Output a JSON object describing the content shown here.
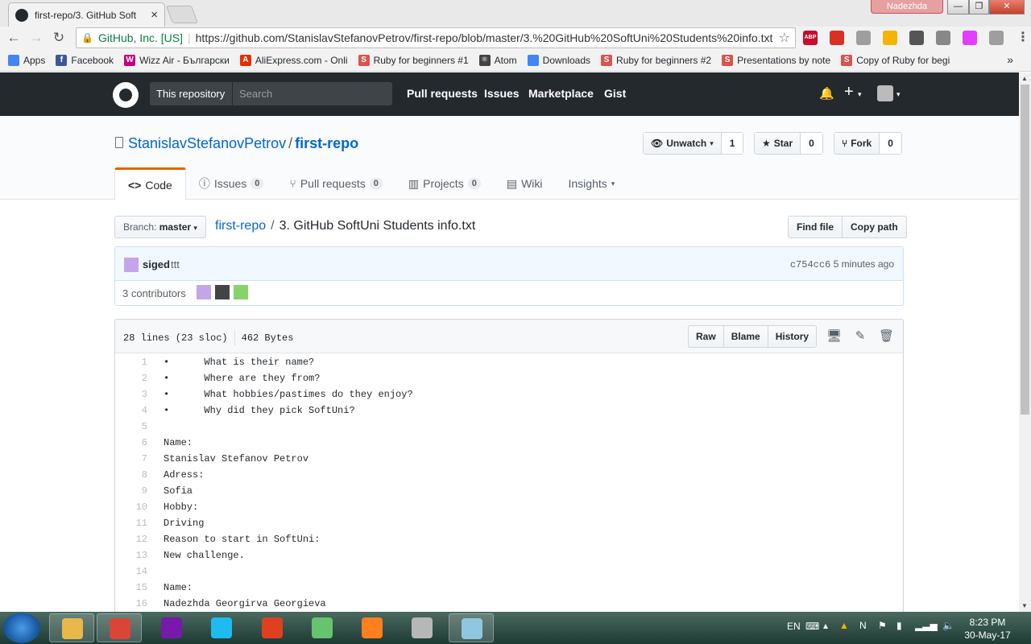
{
  "browser": {
    "tab_title": "first-repo/3. GitHub Soft",
    "tab_close": "×",
    "user_badge": "Nadezhda",
    "window_controls": {
      "minimize": "—",
      "maximize": "❐",
      "close": "✕"
    },
    "nav": {
      "back": "←",
      "forward": "→",
      "reload": "↻"
    },
    "omnibox": {
      "secure_label": "GitHub, Inc. [US]",
      "url": "https://github.com/StanislavStefanovPetrov/first-repo/blob/master/3.%20GitHub%20SoftUni%20Students%20info.txt"
    },
    "extensions": [
      {
        "name": "abp-icon",
        "color": "#c70d2c",
        "label": "ABP"
      },
      {
        "name": "red-ext-icon",
        "color": "#d93025",
        "label": ""
      },
      {
        "name": "drive-ext-icon",
        "color": "#9e9e9e",
        "label": ""
      },
      {
        "name": "yellow-ext-icon",
        "color": "#f4b400",
        "label": ""
      },
      {
        "name": "tools-ext-icon",
        "color": "#555555",
        "label": ""
      },
      {
        "name": "gear-ext-icon",
        "color": "#888888",
        "label": ""
      },
      {
        "name": "gradient-ext-icon",
        "color": "#e040fb",
        "label": ""
      },
      {
        "name": "pdf-ext-icon",
        "color": "#9e9e9e",
        "label": ""
      },
      {
        "name": "menu-icon",
        "color": "#555555",
        "label": "⋮"
      }
    ],
    "bookmarks": [
      {
        "label": "Apps",
        "icon": "apps-icon",
        "color": "#4285f4",
        "glyph": ""
      },
      {
        "label": "Facebook",
        "icon": "facebook-icon",
        "color": "#3b5998",
        "glyph": "f"
      },
      {
        "label": "Wizz Air - Български",
        "icon": "wizzair-icon",
        "color": "#c6007e",
        "glyph": "W"
      },
      {
        "label": "AliExpress.com - Onli",
        "icon": "aliexpress-icon",
        "color": "#e62e04",
        "glyph": "A"
      },
      {
        "label": "Ruby for beginners #1",
        "icon": "softuni-icon",
        "color": "#d9534f",
        "glyph": "S"
      },
      {
        "label": "Atom",
        "icon": "atom-icon",
        "color": "#444444",
        "glyph": "⚛"
      },
      {
        "label": "Downloads",
        "icon": "downloads-icon",
        "color": "#4285f4",
        "glyph": ""
      },
      {
        "label": "Ruby for beginners #2",
        "icon": "softuni-icon",
        "color": "#d9534f",
        "glyph": "S"
      },
      {
        "label": "Presentations by note",
        "icon": "softuni-icon",
        "color": "#d9534f",
        "glyph": "S"
      },
      {
        "label": "Copy of Ruby for begi",
        "icon": "softuni-icon",
        "color": "#d9534f",
        "glyph": "S"
      }
    ],
    "bookmarks_more": "»"
  },
  "github": {
    "scope": "This repository",
    "search_placeholder": "Search",
    "nav": [
      "Pull requests",
      "Issues",
      "Marketplace",
      "Gist"
    ],
    "plus": "+",
    "caret": "▾",
    "bell": "🔔"
  },
  "repo": {
    "owner": "StanislavStefanovPetrov",
    "separator": "/",
    "name": "first-repo",
    "watch": {
      "label": "Unwatch",
      "count": "1"
    },
    "star": {
      "label": "Star",
      "count": "0"
    },
    "fork": {
      "label": "Fork",
      "count": "0"
    },
    "tabs": [
      {
        "label": "Code",
        "count": null,
        "icon": "<>"
      },
      {
        "label": "Issues",
        "count": "0",
        "icon": "ⓘ"
      },
      {
        "label": "Pull requests",
        "count": "0",
        "icon": "⑂"
      },
      {
        "label": "Projects",
        "count": "0",
        "icon": "▥"
      },
      {
        "label": "Wiki",
        "count": null,
        "icon": "▤"
      },
      {
        "label": "Insights",
        "count": null,
        "icon": ""
      }
    ]
  },
  "file_nav": {
    "branch_label": "Branch:",
    "branch_value": "master",
    "breadcrumb_repo": "first-repo",
    "breadcrumb_sep": "/",
    "file_name": "3. GitHub SoftUni Students info.txt",
    "find_file": "Find file",
    "copy_path": "Copy path"
  },
  "commit": {
    "author": "siged",
    "message": "ttt",
    "sha": "c754cc6",
    "time": "5 minutes ago",
    "contributors_label": "3 contributors"
  },
  "file": {
    "lines_info": "28 lines (23 sloc)",
    "size": "462 Bytes",
    "raw": "Raw",
    "blame": "Blame",
    "history": "History",
    "lines": [
      "•\tWhat is their name?",
      "•\tWhere are they from?",
      "•\tWhat hobbies/pastimes do they enjoy?",
      "•\tWhy did they pick SoftUni?",
      "",
      "Name:",
      "Stanislav Stefanov Petrov",
      "Adress:",
      "Sofia",
      "Hobby:",
      "Driving",
      "Reason to start in SoftUni:",
      "New challenge.",
      "",
      "Name:",
      "Nadezhda Georgirva Georgieva"
    ]
  },
  "taskbar": {
    "apps": [
      {
        "name": "explorer-taskbar",
        "color": "#e8b84a",
        "open": true
      },
      {
        "name": "chrome-taskbar",
        "color": "#db4437",
        "open": true
      },
      {
        "name": "onenote-taskbar",
        "color": "#7719aa",
        "open": false
      },
      {
        "name": "ie-taskbar",
        "color": "#1ebbee",
        "open": false
      },
      {
        "name": "app-red-taskbar",
        "color": "#e0401f",
        "open": false
      },
      {
        "name": "atom-taskbar",
        "color": "#67c36e",
        "open": false
      },
      {
        "name": "firefox-taskbar",
        "color": "#ff7f1f",
        "open": false
      },
      {
        "name": "opera-taskbar",
        "color": "#b7b7b7",
        "open": false
      },
      {
        "name": "notes-taskbar",
        "color": "#8fc7e0",
        "open": true
      }
    ],
    "lang": "EN",
    "time": "8:23 PM",
    "date": "30-May-17"
  }
}
